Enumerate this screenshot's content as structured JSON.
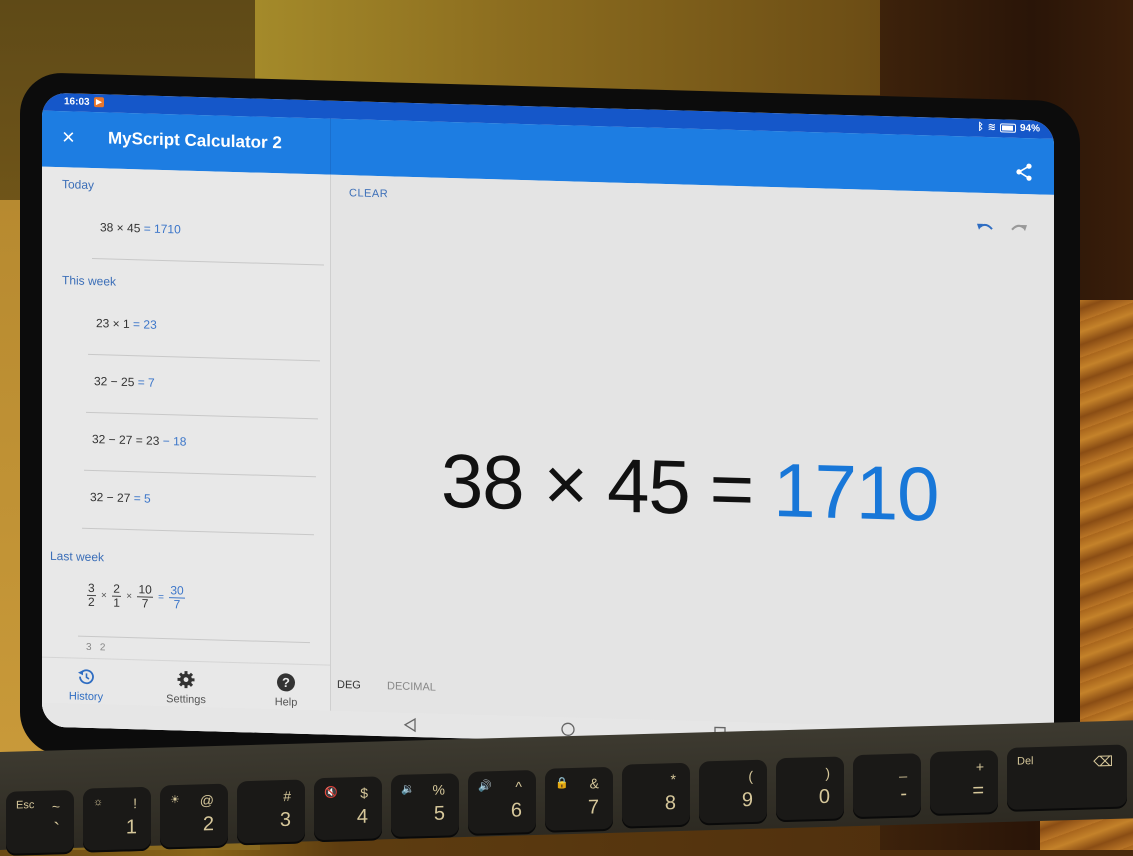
{
  "status_bar": {
    "time": "16:03",
    "notification_icon": "play-store-notification-icon",
    "battery": "94%",
    "icons": [
      "bluetooth-icon",
      "wifi-icon",
      "battery-icon"
    ]
  },
  "app_bar": {
    "close_icon": "×",
    "title": "MyScript Calculator 2",
    "share_icon": "share-icon"
  },
  "sidebar": {
    "sections": [
      {
        "label": "Today",
        "items": [
          {
            "lhs": "38 × 45",
            "rhs": "= 1710"
          }
        ]
      },
      {
        "label": "This week",
        "items": [
          {
            "lhs": "23 × 1",
            "rhs": "= 23"
          },
          {
            "lhs": "32 − 25",
            "rhs": "= 7"
          },
          {
            "lhs": "32 − 27 = 23",
            "rhs": "− 18"
          },
          {
            "lhs": "32 − 27",
            "rhs": "= 5"
          }
        ]
      },
      {
        "label": "Last week",
        "items": [
          {
            "fractions": [
              {
                "n": "3",
                "d": "2"
              },
              {
                "n": "2",
                "d": "1"
              },
              {
                "n": "10",
                "d": "7"
              }
            ],
            "times": "×",
            "equals": "=",
            "result": {
              "n": "30",
              "d": "7"
            }
          },
          {
            "partial": "3   2"
          }
        ]
      }
    ],
    "bottom_nav": [
      {
        "label": "History",
        "icon": "history-icon",
        "active": true
      },
      {
        "label": "Settings",
        "icon": "gear-icon",
        "active": false
      },
      {
        "label": "Help",
        "icon": "help-icon",
        "active": false
      }
    ]
  },
  "main": {
    "clear_label": "CLEAR",
    "expression": "38 × 45 = ",
    "result": "1710",
    "angle_mode": "DEG",
    "number_mode": "DECIMAL",
    "undo_icon": "undo-icon",
    "redo_icon": "redo-icon"
  },
  "system_nav": [
    "back-icon",
    "home-icon",
    "recents-icon"
  ],
  "colors": {
    "app_bar": "#1d7de2",
    "status_bar": "#1557c9",
    "accent": "#1877d8",
    "section_label": "#3c6fb8"
  },
  "keyboard": {
    "keys": [
      {
        "fn": "Esc",
        "top": "~",
        "bot": "`"
      },
      {
        "fn": "☼",
        "top": "!",
        "bot": "1"
      },
      {
        "fn": "☀",
        "top": "@",
        "bot": "2"
      },
      {
        "fn": "",
        "top": "#",
        "bot": "3"
      },
      {
        "fn": "🔇",
        "top": "$",
        "bot": "4"
      },
      {
        "fn": "🔉",
        "top": "%",
        "bot": "5"
      },
      {
        "fn": "🔊",
        "top": "^",
        "bot": "6"
      },
      {
        "fn": "🔒",
        "top": "&",
        "bot": "7"
      },
      {
        "fn": "",
        "top": "*",
        "bot": "8"
      },
      {
        "fn": "",
        "top": "(",
        "bot": "9"
      },
      {
        "fn": "",
        "top": ")",
        "bot": "0"
      },
      {
        "fn": "",
        "top": "_",
        "bot": "-"
      },
      {
        "fn": "",
        "top": "+",
        "bot": "="
      },
      {
        "fn": "Del",
        "top": "⌫",
        "bot": ""
      }
    ]
  }
}
